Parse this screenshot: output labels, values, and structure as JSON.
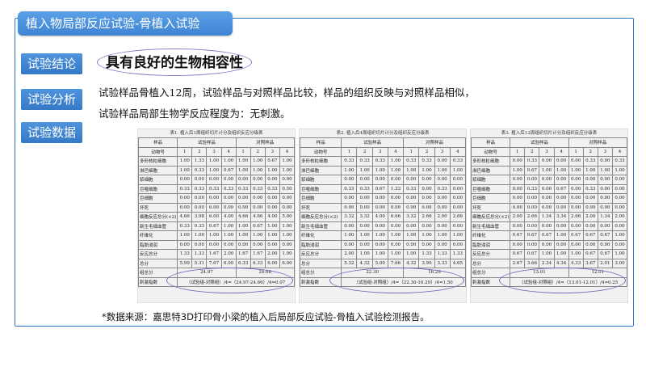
{
  "title": "植入物局部反应试验-骨植入试验",
  "labels": {
    "conclusion": "试验结论",
    "analysis": "试验分析",
    "data": "试验数据"
  },
  "conclusion_text": "具有良好的生物相容性",
  "analysis_lines": [
    "试验样品骨植入12周，试验样品与对照样品比较，样品的组织反映与对照样品相似，",
    "试验样品局部生物学反应程度为：无刺激。"
  ],
  "footnote": "*数据来源：嘉思特3D打印骨小梁的植入后局部反应试验-骨植入试验检测报告。",
  "tables": [
    {
      "caption": "表1. 植入后1周组织切片计分及组织反应分级表",
      "h1": [
        "样品",
        "试验样品",
        "对照样品"
      ],
      "h2": [
        "动物号",
        "1",
        "2",
        "3",
        "4",
        "1",
        "2",
        "3",
        "4"
      ],
      "rows": [
        [
          "多形核粒细胞",
          "1.00",
          "1.33",
          "1.00",
          "1.00",
          "1.00",
          "1.00",
          "0.67",
          "1.00"
        ],
        [
          "淋巴细胞",
          "1.00",
          "0.33",
          "1.00",
          "0.67",
          "1.00",
          "1.00",
          "1.00",
          "1.00"
        ],
        [
          "浆细胞",
          "0.00",
          "0.00",
          "0.00",
          "0.00",
          "0.00",
          "0.00",
          "0.00",
          "0.00"
        ],
        [
          "巨噬细胞",
          "0.33",
          "0.33",
          "0.33",
          "0.33",
          "0.33",
          "0.33",
          "0.33",
          "0.50"
        ],
        [
          "巨细胞",
          "0.00",
          "0.00",
          "0.00",
          "0.00",
          "0.00",
          "0.00",
          "0.00",
          "0.00"
        ],
        [
          "坏死",
          "0.00",
          "0.00",
          "0.00",
          "0.00",
          "0.00",
          "0.00",
          "0.00",
          "0.00"
        ],
        [
          "细胞反应总分(×2)",
          "4.66",
          "3.98",
          "6.00",
          "4.00",
          "4.66",
          "4.66",
          "4.00",
          "5.00"
        ],
        [
          "新生毛细血管",
          "0.33",
          "0.33",
          "0.67",
          "1.00",
          "1.00",
          "0.67",
          "1.00",
          "1.00"
        ],
        [
          "纤维化",
          "1.00",
          "1.00",
          "1.00",
          "1.00",
          "1.00",
          "1.00",
          "1.00",
          "1.00"
        ],
        [
          "脂肪浸润",
          "0.00",
          "0.00",
          "0.00",
          "0.00",
          "0.00",
          "0.00",
          "0.00",
          "0.00"
        ],
        [
          "反应总分",
          "1.33",
          "1.33",
          "1.67",
          "2.00",
          "1.67",
          "1.67",
          "2.00",
          "1.00"
        ],
        [
          "总分",
          "5.99",
          "5.31",
          "7.67",
          "6.00",
          "6.33",
          "6.33",
          "6.00",
          "6.00"
        ]
      ],
      "group_label": "组总分",
      "group_values": [
        "24.97",
        "24.66"
      ],
      "grade_label": "刺激指数",
      "grade_text": "（试验组-对照组）/4=（24.97-24.66）/4=0.07"
    },
    {
      "caption": "表2. 植入后4周组织切片计分及组织反应分级表",
      "h1": [
        "样品",
        "试验样品",
        "对照样品"
      ],
      "h2": [
        "动物号",
        "1",
        "2",
        "3",
        "4",
        "1",
        "2",
        "3",
        "4"
      ],
      "rows": [
        [
          "多形核粒细胞",
          "0.33",
          "0.33",
          "0.33",
          "1.00",
          "0.33",
          "0.33",
          "0.00",
          "0.33"
        ],
        [
          "淋巴细胞",
          "1.00",
          "1.00",
          "1.00",
          "1.00",
          "1.00",
          "1.00",
          "1.00",
          "1.00"
        ],
        [
          "浆细胞",
          "0.00",
          "0.00",
          "0.00",
          "0.00",
          "0.00",
          "0.00",
          "0.00",
          "0.00"
        ],
        [
          "巨噬细胞",
          "0.33",
          "0.33",
          "0.67",
          "1.33",
          "0.33",
          "0.00",
          "0.33",
          "0.00"
        ],
        [
          "巨细胞",
          "0.00",
          "0.00",
          "0.00",
          "0.00",
          "0.00",
          "0.00",
          "0.00",
          "0.00"
        ],
        [
          "坏死",
          "0.00",
          "0.00",
          "0.00",
          "0.00",
          "0.00",
          "0.00",
          "0.00",
          "0.00"
        ],
        [
          "细胞反应总分(×2)",
          "3.32",
          "3.32",
          "4.00",
          "6.66",
          "3.32",
          "2.66",
          "2.00",
          "2.66"
        ],
        [
          "新生毛细血管",
          "0.00",
          "0.00",
          "0.00",
          "0.00",
          "0.00",
          "0.00",
          "0.00",
          "0.00"
        ],
        [
          "纤维化",
          "1.00",
          "1.00",
          "1.00",
          "1.00",
          "1.00",
          "1.00",
          "1.00",
          "1.00"
        ],
        [
          "脂肪浸润",
          "0.00",
          "0.00",
          "0.00",
          "0.00",
          "0.00",
          "0.00",
          "0.00",
          "0.00"
        ],
        [
          "反应总分",
          "2.00",
          "1.00",
          "1.00",
          "1.00",
          "1.00",
          "1.33",
          "1.33",
          "1.33"
        ],
        [
          "总分",
          "5.32",
          "4.32",
          "5.00",
          "7.66",
          "4.32",
          "3.99",
          "3.33",
          "4.65"
        ]
      ],
      "group_label": "组总分",
      "group_values": [
        "22.30",
        "16.29"
      ],
      "grade_label": "刺激指数",
      "grade_text": "（试验组-对照组）/4=（22.30-16.29）/4=1.50"
    },
    {
      "caption": "表3. 植入后12周组织切片计分及组织反应分级表",
      "h1": [
        "样品",
        "试验样品",
        "对照样品"
      ],
      "h2": [
        "动物号",
        "1",
        "2",
        "3",
        "4",
        "1",
        "2",
        "3",
        "4"
      ],
      "rows": [
        [
          "多形核粒细胞",
          "0.00",
          "0.33",
          "0.00",
          "0.00",
          "0.00",
          "0.33",
          "0.00",
          "0.33"
        ],
        [
          "淋巴细胞",
          "1.00",
          "0.67",
          "1.00",
          "1.00",
          "1.00",
          "1.00",
          "1.00",
          "1.00"
        ],
        [
          "浆细胞",
          "0.00",
          "0.00",
          "0.00",
          "0.00",
          "0.00",
          "0.00",
          "0.00",
          "0.00"
        ],
        [
          "巨噬细胞",
          "0.00",
          "0.33",
          "0.00",
          "0.67",
          "0.00",
          "0.33",
          "0.00",
          "0.00"
        ],
        [
          "巨细胞",
          "0.00",
          "0.00",
          "0.00",
          "0.00",
          "0.00",
          "0.00",
          "0.00",
          "0.00"
        ],
        [
          "坏死",
          "0.00",
          "0.00",
          "0.00",
          "0.00",
          "0.00",
          "0.00",
          "0.00",
          "0.00"
        ],
        [
          "细胞反应总分(×2)",
          "2.00",
          "2.66",
          "1.34",
          "3.34",
          "2.66",
          "2.00",
          "1.34",
          "2.00"
        ],
        [
          "新生毛细血管",
          "0.00",
          "0.00",
          "0.00",
          "0.00",
          "0.00",
          "0.00",
          "0.00",
          "0.00"
        ],
        [
          "纤维化",
          "0.67",
          "0.67",
          "0.67",
          "1.00",
          "0.67",
          "0.67",
          "0.67",
          "1.00"
        ],
        [
          "脂肪浸润",
          "0.00",
          "0.00",
          "0.00",
          "0.00",
          "0.00",
          "0.00",
          "0.00",
          "0.00"
        ],
        [
          "反应总分",
          "0.67",
          "0.67",
          "1.00",
          "1.00",
          "1.00",
          "0.67",
          "0.67",
          "1.00"
        ],
        [
          "总分",
          "2.67",
          "3.66",
          "2.34",
          "4.34",
          "4.33",
          "3.67",
          "2.01",
          "3.00"
        ]
      ],
      "group_label": "组总分",
      "group_values": [
        "13.01",
        "12.01"
      ],
      "grade_label": "刺激指数",
      "grade_text": "（试验组-对照组）/4=（13.01-12.01）/4=0.25"
    }
  ]
}
